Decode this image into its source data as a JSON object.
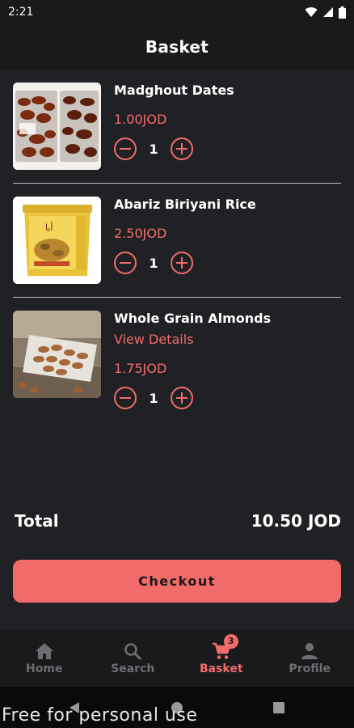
{
  "status_bar": {
    "time": "2:21"
  },
  "header": {
    "title": "Basket"
  },
  "basket": {
    "items": [
      {
        "name": "Madghout Dates",
        "link": "",
        "price": "1.00JOD",
        "quantity": "1",
        "image_icon": "dates-photo"
      },
      {
        "name": "Abariz Biriyani Rice",
        "link": "",
        "price": "2.50JOD",
        "quantity": "1",
        "image_icon": "rice-tub-photo"
      },
      {
        "name": "Whole Grain Almonds",
        "link": "View Details",
        "price": "1.75JOD",
        "quantity": "1",
        "image_icon": "almonds-photo"
      }
    ]
  },
  "summary": {
    "total_label": "Total",
    "total_value": "10.50 JOD"
  },
  "checkout": {
    "label": "Checkout"
  },
  "bottom_nav": {
    "items": [
      {
        "label": "Home",
        "icon": "home-icon",
        "active": false
      },
      {
        "label": "Search",
        "icon": "search-icon",
        "active": false
      },
      {
        "label": "Basket",
        "icon": "cart-icon",
        "active": true,
        "badge": "3"
      },
      {
        "label": "Profile",
        "icon": "person-icon",
        "active": false
      }
    ]
  },
  "watermark": "Free for personal use",
  "colors": {
    "accent": "#f26b6b",
    "background": "#202124",
    "bar": "#1a1a1c",
    "inactive_nav": "#6e6e72"
  }
}
